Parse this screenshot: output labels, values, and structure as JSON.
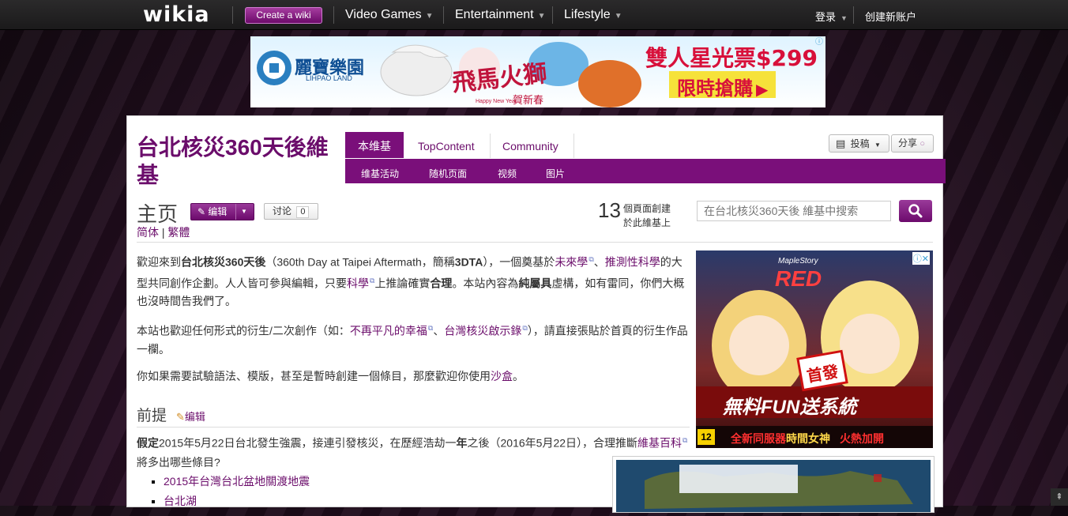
{
  "topbar": {
    "logo": "wikia",
    "create_label": "Create a wiki",
    "nav": [
      {
        "label": "Video Games"
      },
      {
        "label": "Entertainment"
      },
      {
        "label": "Lifestyle"
      }
    ],
    "login_label": "登录",
    "signup_label": "创建新账户"
  },
  "ad_top": {
    "brand_cn": "麗寶樂園",
    "brand_en": "LIHPAO LAND",
    "headline": "雙人星光票$299",
    "cta": "限時搶購",
    "calligraphy": "飛馬火獅",
    "greeting": "賀新春",
    "small": "Happy New Year"
  },
  "wiki": {
    "title": "台北核災360天後維基",
    "tabs": [
      {
        "label": "本维基"
      },
      {
        "label": "TopContent"
      },
      {
        "label": "Community"
      }
    ],
    "subnav": [
      {
        "label": "维基活动"
      },
      {
        "label": "随机页面"
      },
      {
        "label": "视频"
      },
      {
        "label": "图片"
      }
    ],
    "contribute_label": "投稿",
    "share_label": "分享"
  },
  "page": {
    "title": "主页",
    "edit_label": "编辑",
    "talk_label": "讨论",
    "talk_count": "0",
    "lang_simplified": "简体",
    "lang_sep": "|",
    "lang_traditional": "繁體",
    "page_count": "13",
    "page_count_line1": "個頁面創建",
    "page_count_line2": "於此維基上",
    "search_placeholder": "在台北核災360天後 維基中搜索"
  },
  "content": {
    "p1": {
      "t1": "歡迎來到",
      "b1": "台北核災360天後",
      "t2": "（360th Day at Taipei Aftermath，簡稱",
      "b2": "3DTA",
      "t3": "），一個奠基於",
      "l1": "未來學",
      "t4": "、",
      "l2": "推測性科學",
      "t5": "的大型共同創作企劃。人人皆可參與編輯，只要",
      "l3": "科學",
      "t6": "上推論確實",
      "b3": "合理",
      "t7": "。本站內容為",
      "b4": "純屬具",
      "t8": "虛構，如有雷同，你們大概也沒時間告我們了。"
    },
    "p2": {
      "t1": "本站也歡迎任何形式的衍生/二次創作（如：",
      "l1": "不再平凡的幸福",
      "t2": "、",
      "l2": "台灣核災啟示錄",
      "t3": "），請直接張貼於首頁的衍生作品一欄。"
    },
    "p3": {
      "t1": "你如果需要試驗語法、模版，甚至是暫時創建一個條目，那麼歡迎你使用",
      "l1": "沙盒",
      "t2": "。"
    },
    "section_title": "前提",
    "section_edit": "编辑",
    "p4": {
      "b1": "假定",
      "t1": "2015年5月22日台北發生強震，接連引發核災，在歷經浩劫一",
      "b2": "年",
      "t2": "之後（2016年5月22日），合理推斷",
      "l1": "維基百科",
      "t3": "將多出哪些條目?"
    },
    "bullets": [
      {
        "label": "2015年台灣台北盆地關渡地震"
      },
      {
        "label": "台北湖"
      }
    ]
  },
  "ad_side": {
    "game": "MapleStory",
    "title": "RED",
    "badge": "首發",
    "slogan": "無料FUN送系統",
    "rating": "12",
    "footer1": "全新同服器",
    "footer2": "時間女神",
    "footer3": "火熱加開"
  },
  "colors": {
    "brand": "#7a0f7a",
    "link": "#6b0d6b",
    "topbar": "#222222"
  },
  "icons": {
    "search": "search-icon",
    "edit": "pencil-icon",
    "caret": "chevron-down-icon",
    "external": "external-link-icon",
    "scroll": "scroll-top-icon"
  }
}
